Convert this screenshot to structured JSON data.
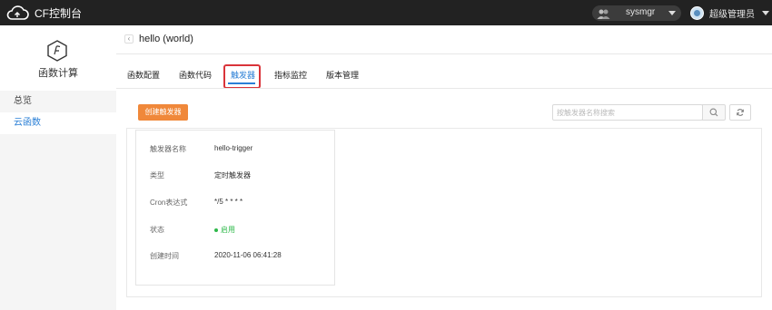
{
  "app": {
    "title": "CF控制台"
  },
  "topbar": {
    "user_select": {
      "value": "sysmgr"
    },
    "admin": {
      "name": "超级管理员"
    }
  },
  "sidebar": {
    "title": "函数计算",
    "items": [
      {
        "label": "总览",
        "active": false
      },
      {
        "label": "云函数",
        "active": true
      }
    ]
  },
  "page": {
    "title": "hello (world)",
    "tabs": [
      {
        "label": "函数配置"
      },
      {
        "label": "函数代码"
      },
      {
        "label": "触发器",
        "active": true
      },
      {
        "label": "指标监控"
      },
      {
        "label": "版本管理"
      }
    ],
    "create_button": "创建触发器",
    "search": {
      "placeholder": "按触发器名称搜索"
    }
  },
  "trigger": {
    "fields": [
      {
        "key": "触发器名称",
        "value": "hello-trigger"
      },
      {
        "key": "类型",
        "value": "定时触发器"
      },
      {
        "key": "Cron表达式",
        "value": "*/5 * * * *"
      },
      {
        "key": "状态",
        "value": "启用"
      },
      {
        "key": "创建时间",
        "value": "2020-11-06 06:41:28"
      }
    ]
  },
  "colors": {
    "accent": "#2a7fd6",
    "create_button": "#f0883a",
    "highlight": "#d9343a",
    "status_on": "#2eb84a",
    "topbar": "#222222"
  }
}
